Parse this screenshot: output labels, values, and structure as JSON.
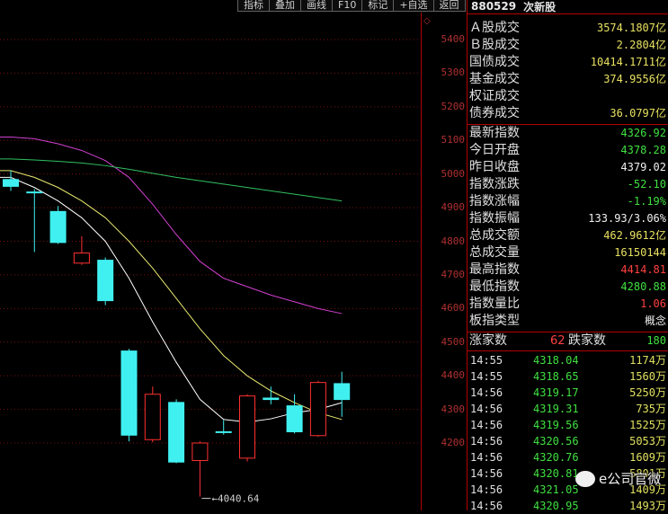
{
  "toolbar": {
    "buttons": [
      "指标",
      "叠加",
      "画线",
      "F10",
      "标记",
      "+自选",
      "返回"
    ]
  },
  "header": {
    "code": "880529",
    "name": "次新股"
  },
  "y_axis": {
    "ticks": [
      "5400",
      "5300",
      "5200",
      "5100",
      "5000",
      "4900",
      "4800",
      "4700",
      "4600",
      "4500",
      "4400",
      "4300",
      "4200"
    ]
  },
  "chart_data": {
    "type": "candlestick",
    "y_range": [
      4130,
      5440
    ],
    "candles": [
      {
        "o": 4985,
        "h": 5010,
        "l": 4950,
        "c": 4962,
        "color": "cyan"
      },
      {
        "o": 4948,
        "h": 4955,
        "l": 4768,
        "c": 4948,
        "color": "cyan"
      },
      {
        "o": 4890,
        "h": 4905,
        "l": 4792,
        "c": 4795,
        "color": "cyan"
      },
      {
        "o": 4735,
        "h": 4815,
        "l": 4730,
        "c": 4765,
        "color": "red"
      },
      {
        "o": 4745,
        "h": 4752,
        "l": 4610,
        "c": 4622,
        "color": "cyan"
      },
      {
        "o": 4475,
        "h": 4480,
        "l": 4205,
        "c": 4222,
        "color": "cyan"
      },
      {
        "o": 4210,
        "h": 4368,
        "l": 4202,
        "c": 4345,
        "color": "red"
      },
      {
        "o": 4322,
        "h": 4330,
        "l": 4140,
        "c": 4142,
        "color": "cyan"
      },
      {
        "o": 4148,
        "h": 4205,
        "l": 4040.64,
        "c": 4200,
        "color": "red"
      },
      {
        "o": 4235,
        "h": 4268,
        "l": 4225,
        "c": 4232,
        "color": "cyan"
      },
      {
        "o": 4155,
        "h": 4345,
        "l": 4145,
        "c": 4340,
        "color": "red"
      },
      {
        "o": 4335,
        "h": 4368,
        "l": 4315,
        "c": 4328,
        "color": "cyan"
      },
      {
        "o": 4312,
        "h": 4345,
        "l": 4228,
        "c": 4232,
        "color": "cyan"
      },
      {
        "o": 4222,
        "h": 4385,
        "l": 4218,
        "c": 4380,
        "color": "red"
      },
      {
        "o": 4378,
        "h": 4412,
        "l": 4278,
        "c": 4328,
        "color": "cyan"
      }
    ],
    "ma_lines": [
      {
        "color": "#ffffff",
        "values": [
          4990,
          4960,
          4920,
          4870,
          4800,
          4690,
          4560,
          4440,
          4330,
          4270,
          4262,
          4272,
          4290,
          4300,
          4320
        ]
      },
      {
        "color": "#e8e870",
        "values": [
          5010,
          4990,
          4960,
          4920,
          4870,
          4800,
          4720,
          4630,
          4540,
          4460,
          4400,
          4355,
          4320,
          4290,
          4270
        ]
      },
      {
        "color": "#d040d0",
        "values": [
          5110,
          5105,
          5090,
          5070,
          5040,
          4990,
          4910,
          4820,
          4740,
          4690,
          4665,
          4640,
          4620,
          4600,
          4585
        ]
      },
      {
        "color": "#30c060",
        "values": [
          5045,
          5042,
          5038,
          5033,
          5025,
          5014,
          5002,
          4990,
          4980,
          4970,
          4960,
          4950,
          4940,
          4930,
          4920
        ]
      }
    ],
    "low_label": "4040.64"
  },
  "stats": [
    {
      "label": "Ａ股成交",
      "value": "3574.1807亿",
      "color": "yellow"
    },
    {
      "label": "Ｂ股成交",
      "value": "2.2804亿",
      "color": "yellow"
    },
    {
      "label": "国债成交",
      "value": "10414.1711亿",
      "color": "yellow"
    },
    {
      "label": "基金成交",
      "value": "374.9556亿",
      "color": "yellow"
    },
    {
      "label": "权证成交",
      "value": "",
      "color": "yellow"
    },
    {
      "label": "债券成交",
      "value": "36.0797亿",
      "color": "yellow"
    }
  ],
  "index": [
    {
      "label": "最新指数",
      "value": "4326.92",
      "color": "green"
    },
    {
      "label": "今日开盘",
      "value": "4378.28",
      "color": "green"
    },
    {
      "label": "昨日收盘",
      "value": "4379.02",
      "color": "white"
    },
    {
      "label": "指数涨跌",
      "value": "-52.10",
      "color": "green"
    },
    {
      "label": "指数涨幅",
      "value": "-1.19%",
      "color": "green"
    },
    {
      "label": "指数振幅",
      "value": "133.93/3.06%",
      "color": "white"
    },
    {
      "label": "总成交额",
      "value": "462.9612亿",
      "color": "yellow"
    },
    {
      "label": "总成交量",
      "value": "16150144",
      "color": "yellow"
    },
    {
      "label": "最高指数",
      "value": "4414.81",
      "color": "red"
    },
    {
      "label": "最低指数",
      "value": "4280.88",
      "color": "green"
    },
    {
      "label": "指数量比",
      "value": "1.06",
      "color": "red"
    },
    {
      "label": "板指类型",
      "value": "概念",
      "color": "white"
    }
  ],
  "breadth": {
    "up_label": "涨家数",
    "up": "62",
    "down_label": "跌家数",
    "down": "180"
  },
  "ticks": [
    {
      "time": "14:55",
      "price": "4318.04",
      "vol": "1174万"
    },
    {
      "time": "14:55",
      "price": "4318.65",
      "vol": "1560万"
    },
    {
      "time": "14:56",
      "price": "4319.17",
      "vol": "5250万"
    },
    {
      "time": "14:56",
      "price": "4319.31",
      "vol": "735万"
    },
    {
      "time": "14:56",
      "price": "4319.56",
      "vol": "1525万"
    },
    {
      "time": "14:56",
      "price": "4320.56",
      "vol": "5053万"
    },
    {
      "time": "14:56",
      "price": "4320.76",
      "vol": "1609万"
    },
    {
      "time": "14:56",
      "price": "4320.81",
      "vol": "5801万"
    },
    {
      "time": "14:56",
      "price": "4321.05",
      "vol": "1409万"
    },
    {
      "time": "14:56",
      "price": "4320.95",
      "vol": "1493万"
    }
  ],
  "watermark": {
    "text": "e公司官微"
  }
}
